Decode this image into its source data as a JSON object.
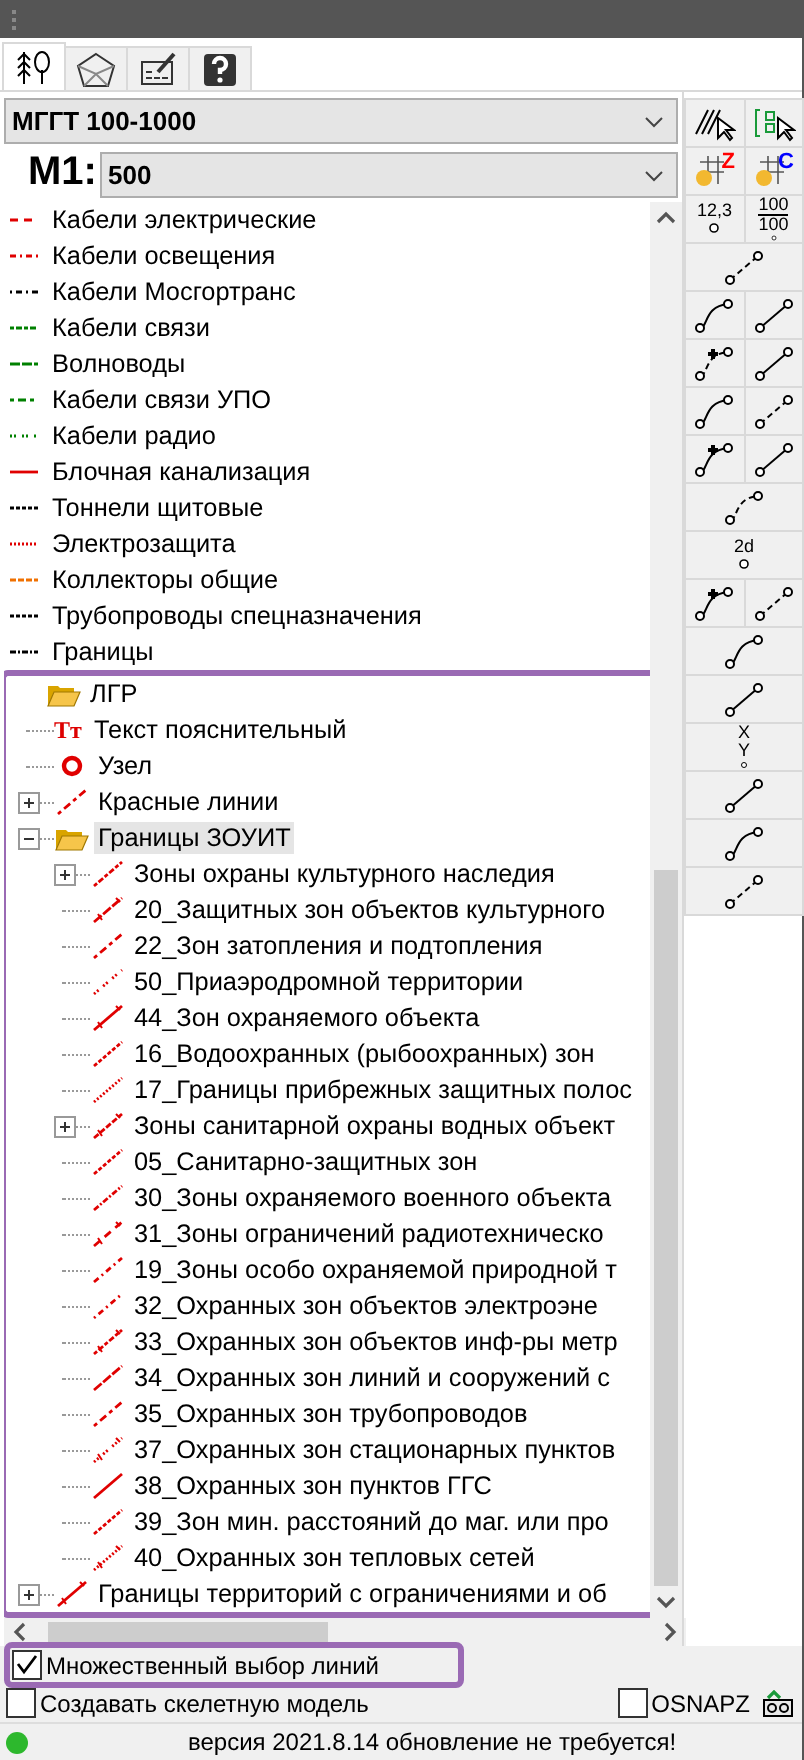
{
  "tabs": [
    {
      "selected": true
    },
    {
      "selected": false
    },
    {
      "selected": false
    },
    {
      "selected": false
    }
  ],
  "classifier": {
    "value": "МГГТ 100-1000"
  },
  "scale": {
    "label": "M1:",
    "value": "500"
  },
  "tree": [
    {
      "label": "Кабели электрические",
      "color": "#e00000",
      "selected": false
    },
    {
      "label": "Кабели освещения",
      "color": "#e00000",
      "selected": false
    },
    {
      "label": "Кабели Мосгортранс",
      "color": "#000000",
      "selected": false
    },
    {
      "label": "Кабели связи",
      "color": "#008000",
      "selected": false
    },
    {
      "label": "Волноводы",
      "color": "#008000",
      "selected": false
    },
    {
      "label": "Кабели связи УПО",
      "color": "#008000",
      "selected": false
    },
    {
      "label": "Кабели радио",
      "color": "#008000",
      "selected": false
    },
    {
      "label": "Блочная канализация",
      "color": "#e00000",
      "selected": false
    },
    {
      "label": "Тоннели щитовые",
      "color": "#000000",
      "selected": false
    },
    {
      "label": "Электрозащита",
      "color": "#e00000",
      "selected": false
    },
    {
      "label": "Коллекторы общие",
      "color": "#f07000",
      "selected": false
    },
    {
      "label": "Трубопроводы спецназначения",
      "color": "#000000",
      "selected": false
    },
    {
      "label": "Границы",
      "color": "#000000",
      "selected": false
    },
    {
      "label": "ЛГР",
      "selected": false,
      "expanded": true,
      "highlighted": true,
      "children": [
        {
          "label": "Текст пояснительный",
          "icon_text": "Tт",
          "selected": false
        },
        {
          "label": "Узел",
          "selected": false
        },
        {
          "label": "Красные линии",
          "selected": false,
          "expanded": false
        },
        {
          "label": "Границы ЗОУИТ",
          "selected": true,
          "expanded": true,
          "children": [
            {
              "label": "Зоны охраны культурного наследия",
              "selected": false,
              "expanded": false
            },
            {
              "label": "20_Защитных зон объектов культурного",
              "selected": false
            },
            {
              "label": "22_Зон затопления и подтопления",
              "selected": false
            },
            {
              "label": "50_Приаэродромной территории",
              "selected": false
            },
            {
              "label": "44_Зон охраняемого объекта",
              "selected": false
            },
            {
              "label": "16_Водоохранных (рыбоохранных) зон",
              "selected": false
            },
            {
              "label": "17_Границы прибрежных защитных полос",
              "selected": false
            },
            {
              "label": "Зоны санитарной охраны водных объект",
              "selected": false,
              "expanded": false
            },
            {
              "label": "05_Санитарно-защитных зон",
              "selected": false
            },
            {
              "label": "30_Зоны охраняемого военного объекта",
              "selected": false
            },
            {
              "label": "31_Зоны ограничений радиотехническо",
              "selected": false
            },
            {
              "label": "19_Зоны особо охраняемой природной т",
              "selected": false
            },
            {
              "label": "32_Охранных зон объектов электроэне",
              "selected": false
            },
            {
              "label": "33_Охранных зон объектов инф-ры метр",
              "selected": false
            },
            {
              "label": "34_Охранных зон линий и сооружений с",
              "selected": false
            },
            {
              "label": "35_Охранных зон трубопроводов",
              "selected": false
            },
            {
              "label": "37_Охранных зон стационарных пунктов",
              "selected": false
            },
            {
              "label": "38_Охранных зон пунктов ГГС",
              "selected": false
            },
            {
              "label": "39_Зон мин. расстояний до маг. или про",
              "selected": false
            },
            {
              "label": "40_Охранных зон тепловых сетей",
              "selected": false
            }
          ]
        },
        {
          "label": "Границы территорий с ограничениями и об",
          "selected": false,
          "expanded": false
        }
      ]
    }
  ],
  "toolbar": [
    {
      "wide": false
    },
    {
      "wide": false
    },
    {
      "wide": false,
      "badge": "Z",
      "color": "#ff0000"
    },
    {
      "wide": false,
      "badge": "C",
      "color": "#0000ff"
    },
    {
      "wide": false,
      "lines": [
        "12,3"
      ]
    },
    {
      "wide": false,
      "lines": [
        "100",
        "100"
      ]
    },
    {
      "wide": true
    },
    {
      "wide": false
    },
    {
      "wide": false
    },
    {
      "wide": false
    },
    {
      "wide": false
    },
    {
      "wide": false
    },
    {
      "wide": false
    },
    {
      "wide": false
    },
    {
      "wide": false
    },
    {
      "wide": true
    },
    {
      "wide": true,
      "lines": [
        "2d"
      ]
    },
    {
      "wide": false
    },
    {
      "wide": false
    },
    {
      "wide": true
    },
    {
      "wide": true
    },
    {
      "wide": true,
      "lines": [
        "X",
        "Y"
      ]
    },
    {
      "wide": true
    },
    {
      "wide": true
    },
    {
      "wide": true
    }
  ],
  "options": [
    {
      "label": "Множественный выбор линий",
      "checked": true,
      "highlighted": true
    },
    {
      "label": "Создавать скелетную модель",
      "checked": false,
      "highlighted": false
    }
  ],
  "osnap": {
    "label": "OSNAPZ",
    "checked": false
  },
  "status": {
    "text": "версия 2021.8.14 обновление не требуется!"
  }
}
